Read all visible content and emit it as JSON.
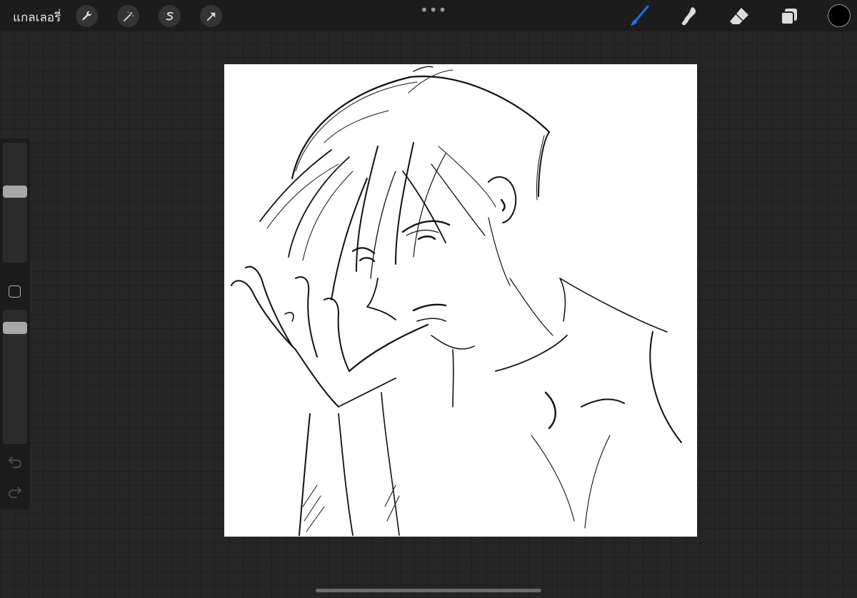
{
  "topbar": {
    "gallery_label": "แกลเลอรี่",
    "left_tools": [
      "wrench-icon",
      "magic-wand-icon",
      "selection-icon",
      "transform-arrow-icon"
    ],
    "more_menu": "•••",
    "right_tools": [
      "brush-icon",
      "smudge-icon",
      "eraser-icon",
      "layers-icon"
    ],
    "active_tool": "brush-icon",
    "active_color": "#1f6feb",
    "current_color": "#000000"
  },
  "sidebar": {
    "controls": [
      "brush-size-slider",
      "modify-button",
      "opacity-slider",
      "undo-icon",
      "redo-icon"
    ]
  },
  "canvas": {
    "background": "#ffffff",
    "content": "sketch-artwork"
  }
}
